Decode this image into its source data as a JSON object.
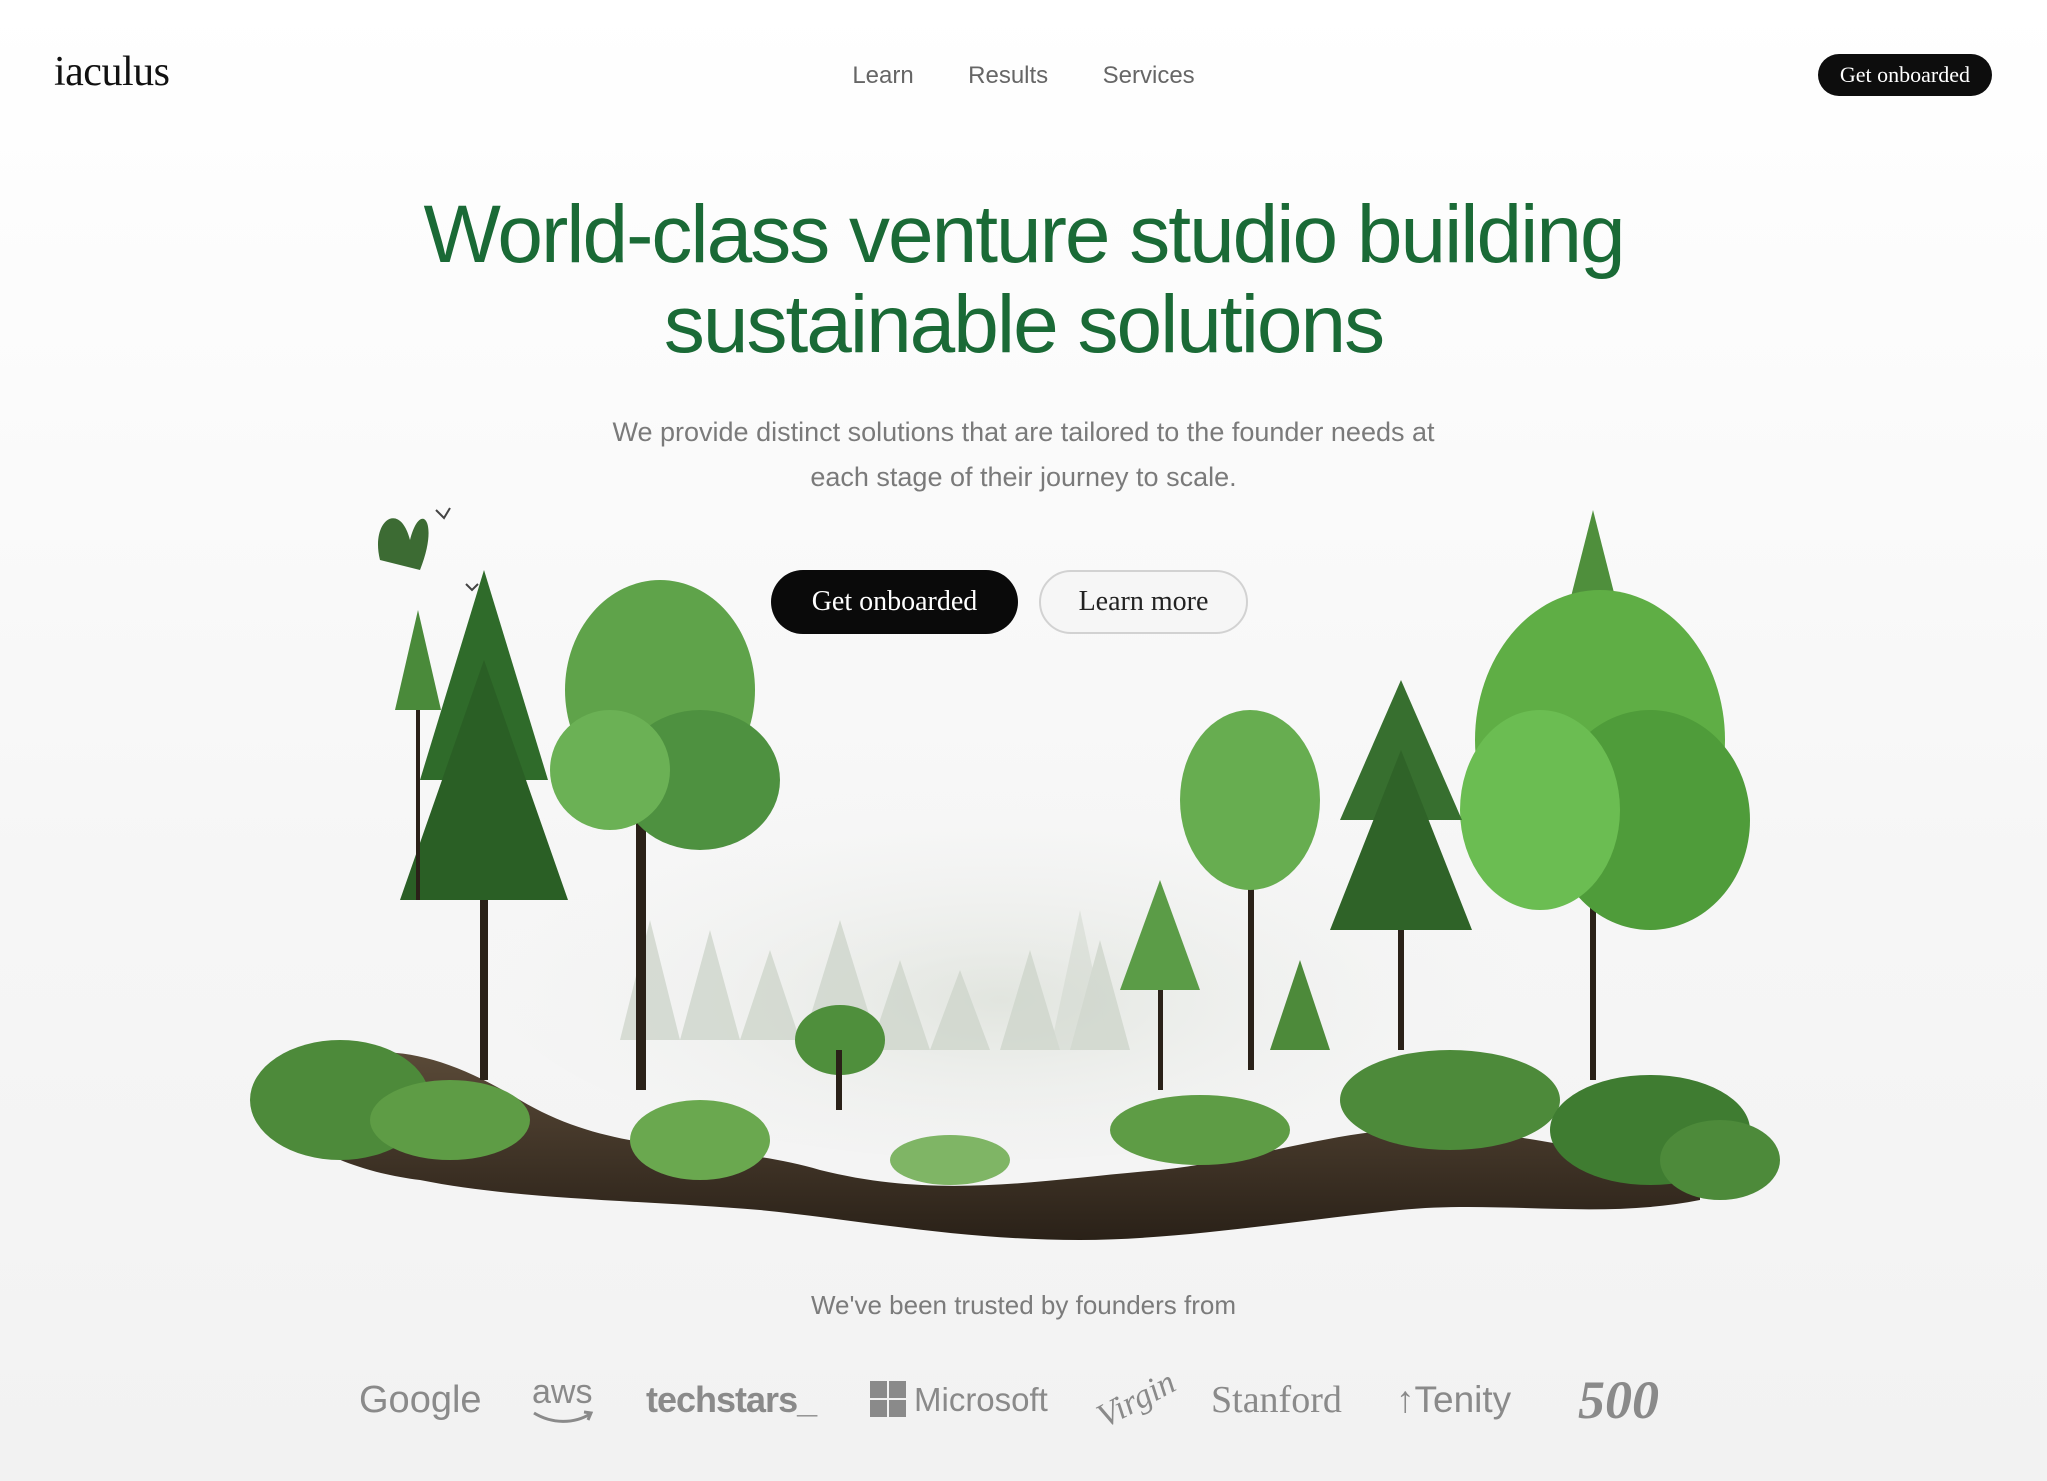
{
  "nav": {
    "logo": "iaculus",
    "links": [
      "Learn",
      "Results",
      "Services"
    ],
    "cta_label": "Get onboarded"
  },
  "hero": {
    "title_line1": "World-class venture studio building",
    "title_line2": "sustainable solutions",
    "subtitle_line1": "We provide distinct solutions that are tailored to the founder needs at",
    "subtitle_line2": "each stage of their journey to scale.",
    "primary_button": "Get onboarded",
    "secondary_button": "Learn more",
    "illustration_icon": "forest-island-illustration"
  },
  "trusted": {
    "label": "We've been trusted by founders from",
    "logos": [
      "Google",
      "aws",
      "techstars_",
      "Microsoft",
      "Virgin",
      "Stanford",
      "Tenity",
      "500"
    ]
  },
  "colors": {
    "heading_green": "#1a6a36",
    "button_dark": "#0a0a0a",
    "muted_text": "#7a7a7a",
    "logo_gray": "#8a8a8a"
  }
}
